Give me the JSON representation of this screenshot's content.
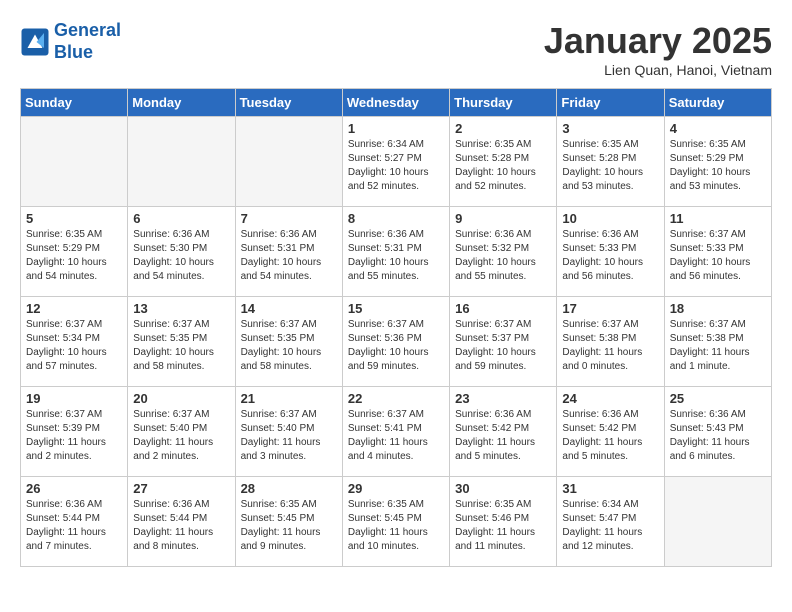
{
  "logo": {
    "line1": "General",
    "line2": "Blue"
  },
  "calendar": {
    "title": "January 2025",
    "subtitle": "Lien Quan, Hanoi, Vietnam"
  },
  "headers": [
    "Sunday",
    "Monday",
    "Tuesday",
    "Wednesday",
    "Thursday",
    "Friday",
    "Saturday"
  ],
  "weeks": [
    [
      {
        "day": "",
        "info": ""
      },
      {
        "day": "",
        "info": ""
      },
      {
        "day": "",
        "info": ""
      },
      {
        "day": "1",
        "info": "Sunrise: 6:34 AM\nSunset: 5:27 PM\nDaylight: 10 hours\nand 52 minutes."
      },
      {
        "day": "2",
        "info": "Sunrise: 6:35 AM\nSunset: 5:28 PM\nDaylight: 10 hours\nand 52 minutes."
      },
      {
        "day": "3",
        "info": "Sunrise: 6:35 AM\nSunset: 5:28 PM\nDaylight: 10 hours\nand 53 minutes."
      },
      {
        "day": "4",
        "info": "Sunrise: 6:35 AM\nSunset: 5:29 PM\nDaylight: 10 hours\nand 53 minutes."
      }
    ],
    [
      {
        "day": "5",
        "info": "Sunrise: 6:35 AM\nSunset: 5:29 PM\nDaylight: 10 hours\nand 54 minutes."
      },
      {
        "day": "6",
        "info": "Sunrise: 6:36 AM\nSunset: 5:30 PM\nDaylight: 10 hours\nand 54 minutes."
      },
      {
        "day": "7",
        "info": "Sunrise: 6:36 AM\nSunset: 5:31 PM\nDaylight: 10 hours\nand 54 minutes."
      },
      {
        "day": "8",
        "info": "Sunrise: 6:36 AM\nSunset: 5:31 PM\nDaylight: 10 hours\nand 55 minutes."
      },
      {
        "day": "9",
        "info": "Sunrise: 6:36 AM\nSunset: 5:32 PM\nDaylight: 10 hours\nand 55 minutes."
      },
      {
        "day": "10",
        "info": "Sunrise: 6:36 AM\nSunset: 5:33 PM\nDaylight: 10 hours\nand 56 minutes."
      },
      {
        "day": "11",
        "info": "Sunrise: 6:37 AM\nSunset: 5:33 PM\nDaylight: 10 hours\nand 56 minutes."
      }
    ],
    [
      {
        "day": "12",
        "info": "Sunrise: 6:37 AM\nSunset: 5:34 PM\nDaylight: 10 hours\nand 57 minutes."
      },
      {
        "day": "13",
        "info": "Sunrise: 6:37 AM\nSunset: 5:35 PM\nDaylight: 10 hours\nand 58 minutes."
      },
      {
        "day": "14",
        "info": "Sunrise: 6:37 AM\nSunset: 5:35 PM\nDaylight: 10 hours\nand 58 minutes."
      },
      {
        "day": "15",
        "info": "Sunrise: 6:37 AM\nSunset: 5:36 PM\nDaylight: 10 hours\nand 59 minutes."
      },
      {
        "day": "16",
        "info": "Sunrise: 6:37 AM\nSunset: 5:37 PM\nDaylight: 10 hours\nand 59 minutes."
      },
      {
        "day": "17",
        "info": "Sunrise: 6:37 AM\nSunset: 5:38 PM\nDaylight: 11 hours\nand 0 minutes."
      },
      {
        "day": "18",
        "info": "Sunrise: 6:37 AM\nSunset: 5:38 PM\nDaylight: 11 hours\nand 1 minute."
      }
    ],
    [
      {
        "day": "19",
        "info": "Sunrise: 6:37 AM\nSunset: 5:39 PM\nDaylight: 11 hours\nand 2 minutes."
      },
      {
        "day": "20",
        "info": "Sunrise: 6:37 AM\nSunset: 5:40 PM\nDaylight: 11 hours\nand 2 minutes."
      },
      {
        "day": "21",
        "info": "Sunrise: 6:37 AM\nSunset: 5:40 PM\nDaylight: 11 hours\nand 3 minutes."
      },
      {
        "day": "22",
        "info": "Sunrise: 6:37 AM\nSunset: 5:41 PM\nDaylight: 11 hours\nand 4 minutes."
      },
      {
        "day": "23",
        "info": "Sunrise: 6:36 AM\nSunset: 5:42 PM\nDaylight: 11 hours\nand 5 minutes."
      },
      {
        "day": "24",
        "info": "Sunrise: 6:36 AM\nSunset: 5:42 PM\nDaylight: 11 hours\nand 5 minutes."
      },
      {
        "day": "25",
        "info": "Sunrise: 6:36 AM\nSunset: 5:43 PM\nDaylight: 11 hours\nand 6 minutes."
      }
    ],
    [
      {
        "day": "26",
        "info": "Sunrise: 6:36 AM\nSunset: 5:44 PM\nDaylight: 11 hours\nand 7 minutes."
      },
      {
        "day": "27",
        "info": "Sunrise: 6:36 AM\nSunset: 5:44 PM\nDaylight: 11 hours\nand 8 minutes."
      },
      {
        "day": "28",
        "info": "Sunrise: 6:35 AM\nSunset: 5:45 PM\nDaylight: 11 hours\nand 9 minutes."
      },
      {
        "day": "29",
        "info": "Sunrise: 6:35 AM\nSunset: 5:45 PM\nDaylight: 11 hours\nand 10 minutes."
      },
      {
        "day": "30",
        "info": "Sunrise: 6:35 AM\nSunset: 5:46 PM\nDaylight: 11 hours\nand 11 minutes."
      },
      {
        "day": "31",
        "info": "Sunrise: 6:34 AM\nSunset: 5:47 PM\nDaylight: 11 hours\nand 12 minutes."
      },
      {
        "day": "",
        "info": ""
      }
    ]
  ]
}
